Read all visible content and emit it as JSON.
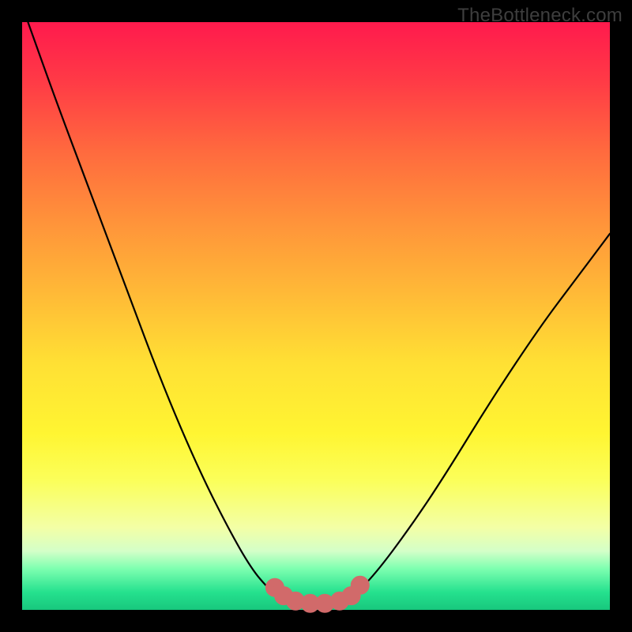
{
  "watermark": "TheBottleneck.com",
  "colors": {
    "frame": "#000000",
    "curve": "#000000",
    "marker_stroke": "#d16a6a",
    "marker_fill": "#d16a6a"
  },
  "chart_data": {
    "type": "line",
    "title": "",
    "xlabel": "",
    "ylabel": "",
    "xlim": [
      0,
      1
    ],
    "ylim": [
      0,
      1
    ],
    "note": "Axes are unlabeled in source; values are normalized 0-1 from pixel positions inside the 744x744 plot area (y=0 at bottom).",
    "series": [
      {
        "name": "left-branch",
        "x": [
          0.01,
          0.06,
          0.12,
          0.18,
          0.24,
          0.3,
          0.35,
          0.39,
          0.42,
          0.44
        ],
        "y": [
          1.0,
          0.86,
          0.7,
          0.54,
          0.38,
          0.24,
          0.14,
          0.07,
          0.035,
          0.02
        ]
      },
      {
        "name": "floor",
        "x": [
          0.44,
          0.47,
          0.5,
          0.53,
          0.56
        ],
        "y": [
          0.02,
          0.012,
          0.01,
          0.012,
          0.02
        ]
      },
      {
        "name": "right-branch",
        "x": [
          0.56,
          0.6,
          0.66,
          0.72,
          0.8,
          0.88,
          0.94,
          1.0
        ],
        "y": [
          0.02,
          0.06,
          0.14,
          0.23,
          0.36,
          0.48,
          0.56,
          0.64
        ]
      }
    ],
    "markers": {
      "name": "bottleneck-zone",
      "x": [
        0.43,
        0.445,
        0.465,
        0.49,
        0.515,
        0.54,
        0.56,
        0.575
      ],
      "y": [
        0.038,
        0.024,
        0.015,
        0.011,
        0.011,
        0.015,
        0.024,
        0.042
      ]
    }
  }
}
